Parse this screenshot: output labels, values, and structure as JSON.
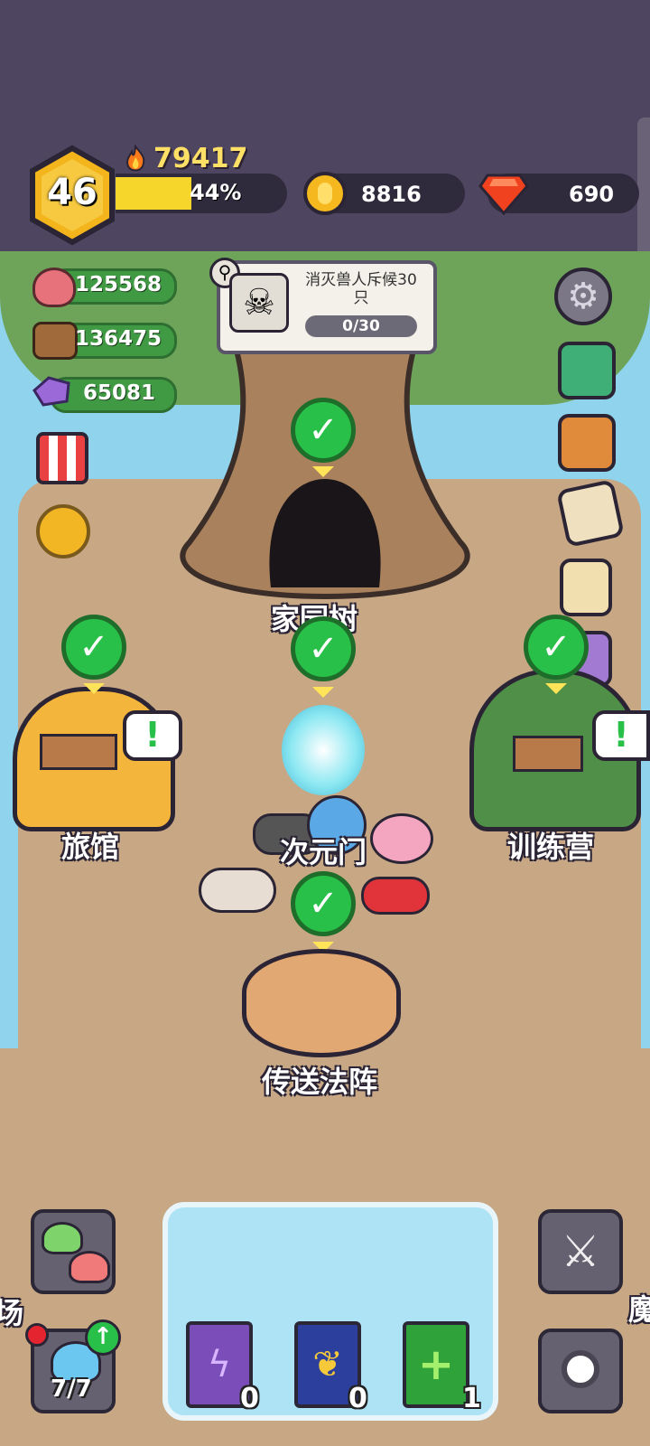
{
  "player": {
    "level": "46",
    "power": "79417",
    "xp_percent_label": "44%",
    "xp_fraction": 0.44
  },
  "currency": {
    "gold": "8816",
    "gems": "690"
  },
  "resources": {
    "meat": "125568",
    "wood": "136475",
    "crystal": "65081"
  },
  "quest": {
    "title": "消灭兽人斥候30只",
    "progress": "0/30"
  },
  "buildings": {
    "home_tree": "家园树",
    "inn": "旅馆",
    "portal": "次元门",
    "training_camp": "训练营",
    "teleport_circle": "传送法阵",
    "left_edge_partial": "场",
    "right_edge_partial": "魔"
  },
  "bottom": {
    "slime_capacity": "7/7",
    "books": [
      {
        "name": "lightning-book",
        "count": "0",
        "color": "#7a4db8"
      },
      {
        "name": "feather-book",
        "count": "0",
        "color": "#2c3f9c"
      },
      {
        "name": "heal-book",
        "count": "1",
        "color": "#2fa33a"
      }
    ]
  },
  "colors": {
    "top_bar": "#4e4660",
    "check": "#29c049",
    "xp": "#f7d62b",
    "resource_pill": "#3f9a43"
  }
}
